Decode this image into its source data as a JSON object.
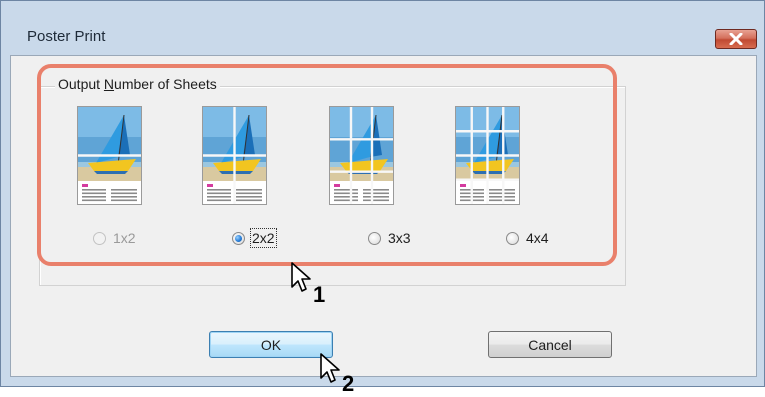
{
  "window": {
    "title": "Poster Print",
    "close_icon": "close-icon"
  },
  "group": {
    "label_prefix": "Output ",
    "label_mnemonic": "N",
    "label_suffix": "umber of Sheets"
  },
  "options": [
    {
      "label": "1x2",
      "rows": 2,
      "cols": 1,
      "selected": false,
      "enabled": false
    },
    {
      "label": "2x2",
      "rows": 2,
      "cols": 2,
      "selected": true,
      "enabled": true
    },
    {
      "label": "3x3",
      "rows": 3,
      "cols": 3,
      "selected": false,
      "enabled": true
    },
    {
      "label": "4x4",
      "rows": 4,
      "cols": 4,
      "selected": false,
      "enabled": true
    }
  ],
  "buttons": {
    "ok_label": "OK",
    "cancel_label": "Cancel"
  },
  "annotations": {
    "step1": "1",
    "step2": "2"
  },
  "colors": {
    "highlight": "#e9806b",
    "accent": "#2a7fd8"
  }
}
